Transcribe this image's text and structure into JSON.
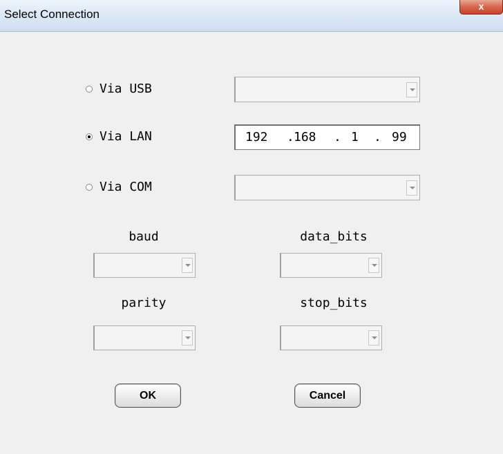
{
  "window": {
    "title": "Select Connection",
    "close_label": "x"
  },
  "connection": {
    "usb": {
      "label": "Via USB",
      "selected": false,
      "value": ""
    },
    "lan": {
      "label": "Via LAN",
      "selected": true,
      "ip": [
        "192",
        "168",
        "1",
        "99"
      ]
    },
    "com": {
      "label": "Via COM",
      "selected": false,
      "value": ""
    }
  },
  "serial": {
    "baud_label": "baud",
    "data_bits_label": "data_bits",
    "parity_label": "parity",
    "stop_bits_label": "stop_bits"
  },
  "buttons": {
    "ok": "OK",
    "cancel": "Cancel"
  }
}
